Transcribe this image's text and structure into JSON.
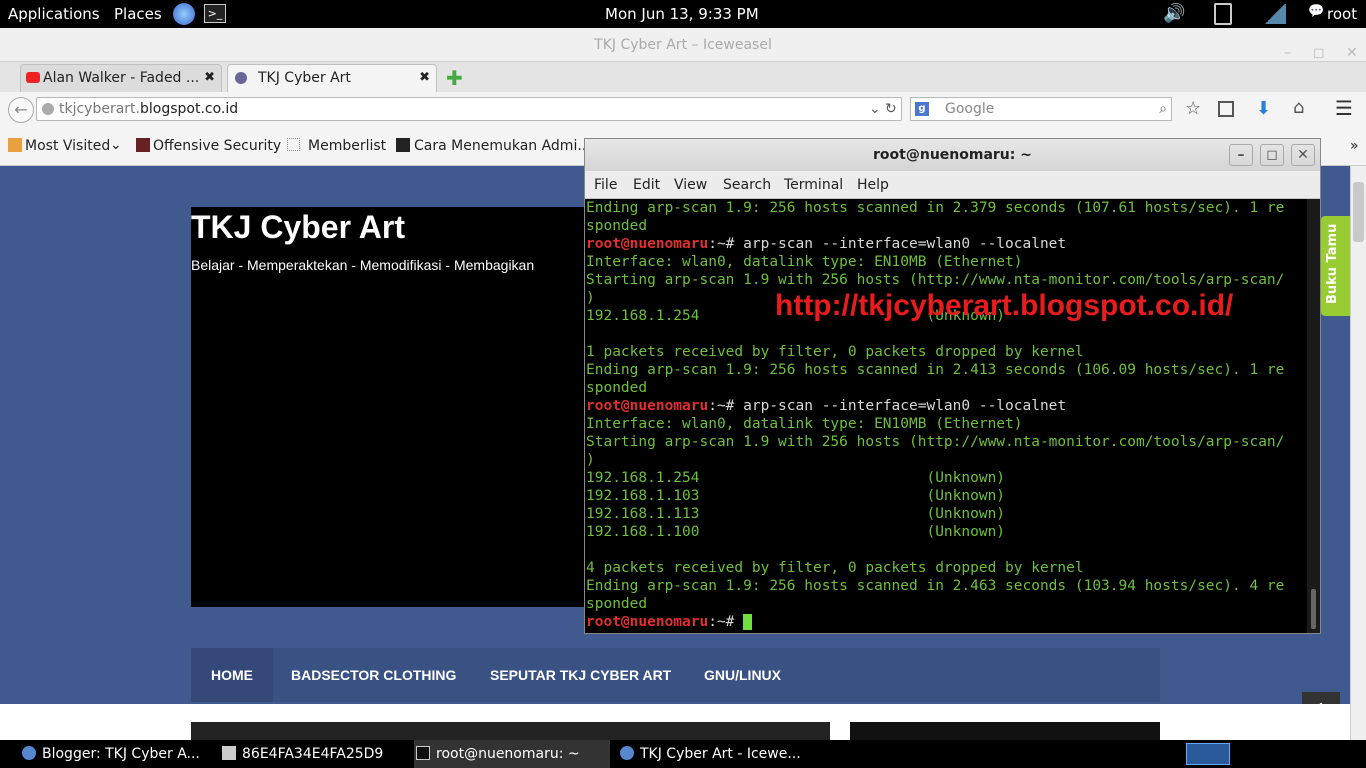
{
  "top_panel": {
    "applications": "Applications",
    "places": "Places",
    "clock": "Mon Jun 13,  9:33 PM",
    "user": "root"
  },
  "browser": {
    "window_title": "TKJ Cyber Art – Iceweasel",
    "tabs": [
      {
        "label": "Alan Walker - Faded ...",
        "close": "✖"
      },
      {
        "label": "TKJ Cyber Art",
        "close": "✖"
      }
    ],
    "url_prefix": "tkjcyberart.",
    "url_host": "blogspot.co.id",
    "search_placeholder": "Google",
    "bookmarks": [
      "Most Visited",
      "Offensive Security",
      "Memberlist",
      "Cara Menemukan Admi..."
    ],
    "overflow": "»"
  },
  "page": {
    "site_title": "TKJ Cyber Art",
    "site_description": "Belajar - Memperaktekan - Memodifikasi - Membagikan",
    "menu": [
      "HOME",
      "BADSECTOR CLOTHING",
      "SEPUTAR TKJ CYBER ART",
      "GNU/LINUX"
    ],
    "side_tab": "Buku Tamu"
  },
  "terminal": {
    "title": "root@nuenomaru: ~",
    "menu": [
      "File",
      "Edit",
      "View",
      "Search",
      "Terminal",
      "Help"
    ],
    "watermark": "http://tkjcyberart.blogspot.co.id/",
    "lines": [
      {
        "t": "Ending arp-scan 1.9: 256 hosts scanned in 2.379 seconds (107.61 hosts/sec). 1 re"
      },
      {
        "t": "sponded"
      },
      {
        "p": "root@nuenomaru",
        "t": ":~# arp-scan --interface=wlan0 --localnet"
      },
      {
        "t": "Interface: wlan0, datalink type: EN10MB (Ethernet)"
      },
      {
        "t": "Starting arp-scan 1.9 with 256 hosts (http://www.nta-monitor.com/tools/arp-scan/"
      },
      {
        "t": ")"
      },
      {
        "t": "192.168.1.254                          (Unknown)"
      },
      {
        "t": ""
      },
      {
        "t": "1 packets received by filter, 0 packets dropped by kernel"
      },
      {
        "t": "Ending arp-scan 1.9: 256 hosts scanned in 2.413 seconds (106.09 hosts/sec). 1 re"
      },
      {
        "t": "sponded"
      },
      {
        "p": "root@nuenomaru",
        "t": ":~# arp-scan --interface=wlan0 --localnet"
      },
      {
        "t": "Interface: wlan0, datalink type: EN10MB (Ethernet)"
      },
      {
        "t": "Starting arp-scan 1.9 with 256 hosts (http://www.nta-monitor.com/tools/arp-scan/"
      },
      {
        "t": ")"
      },
      {
        "t": "192.168.1.254                          (Unknown)"
      },
      {
        "t": "192.168.1.103                          (Unknown)"
      },
      {
        "t": "192.168.1.113                          (Unknown)"
      },
      {
        "t": "192.168.1.100                          (Unknown)"
      },
      {
        "t": ""
      },
      {
        "t": "4 packets received by filter, 0 packets dropped by kernel"
      },
      {
        "t": "Ending arp-scan 1.9: 256 hosts scanned in 2.463 seconds (103.94 hosts/sec). 4 re"
      },
      {
        "t": "sponded"
      },
      {
        "p": "root@nuenomaru",
        "t": ":~# ",
        "cursor": true
      }
    ]
  },
  "taskbar": {
    "tasks": [
      "Blogger: TKJ Cyber A...",
      "86E4FA34E4FA25D9",
      "root@nuenomaru: ~",
      "TKJ Cyber Art - Icewe..."
    ]
  },
  "colors": {
    "page_bg": "#40598e",
    "menu_bg": "#3a5183",
    "terminal_green": "#6fbf3d",
    "prompt_red": "#e03030",
    "watermark_red": "#e81c1c"
  }
}
